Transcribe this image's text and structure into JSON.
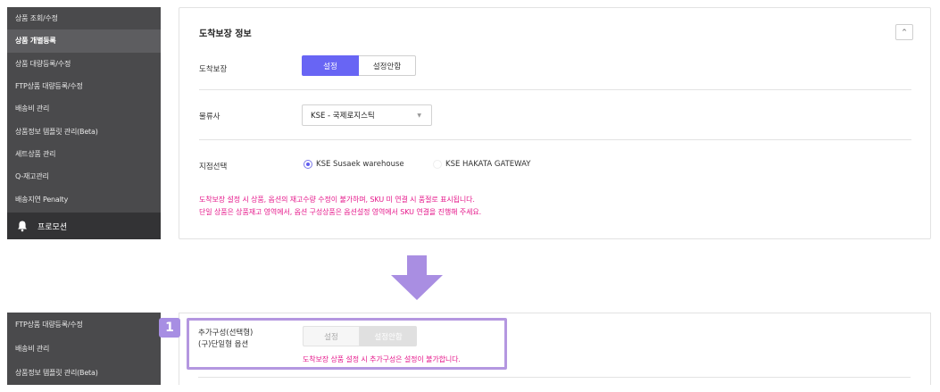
{
  "top": {
    "sidebar": {
      "items": [
        {
          "label": "상품 조회/수정"
        },
        {
          "label": "상품 개별등록"
        },
        {
          "label": "상품 대량등록/수정"
        },
        {
          "label": "FTP상품 대량등록/수정"
        },
        {
          "label": "배송비 관리"
        },
        {
          "label": "상품정보 템플릿 관리(Beta)"
        },
        {
          "label": "세트상품 관리"
        },
        {
          "label": "Q-재고관리"
        },
        {
          "label": "배송지연 Penalty"
        }
      ],
      "active_index": 1,
      "promo_label": "프로모션",
      "promo_icon": "bell-icon"
    },
    "panel": {
      "title": "도착보장 정보",
      "collapse_icon": "chevron-up-icon",
      "collapse_glyph": "^",
      "guarantee": {
        "label": "도착보장",
        "options": [
          "설정",
          "설정안함"
        ],
        "selected": "설정"
      },
      "logistics": {
        "label": "물류사",
        "selected_value": "KSE - 국제로지스틱"
      },
      "branch": {
        "label": "지점선택",
        "options": [
          {
            "label": "KSE Susaek warehouse",
            "checked": true
          },
          {
            "label": "KSE HAKATA GATEWAY",
            "checked": false
          }
        ]
      },
      "notices": [
        "도착보장 설정 시 상품, 옵션의 재고수량 수정이 불가하며, SKU 미 연결 시 품절로 표시됩니다.",
        "단일 상품은 상품재고 영역에서, 옵션 구성상품은 옵션설정 영역에서 SKU 연결을 진행해 주세요."
      ]
    }
  },
  "bottom": {
    "sidebar": {
      "items": [
        {
          "label": "FTP상품 대량등록/수정"
        },
        {
          "label": "배송비 관리"
        },
        {
          "label": "상품정보 템플릿 관리(Beta)"
        }
      ]
    },
    "badge": "1",
    "option_label_line1": "추가구성(선택형)",
    "option_label_line2": "(구)단일형 옵션",
    "options": [
      "설정",
      "설정안함"
    ],
    "notice": "도착보장 상품 설정 시 추가구성은 설정이 불가합니다."
  },
  "colors": {
    "accent": "#6865f4",
    "notice": "#e6188b",
    "highlight": "#b497e0",
    "sidebar_bg": "#4a4a4c"
  }
}
